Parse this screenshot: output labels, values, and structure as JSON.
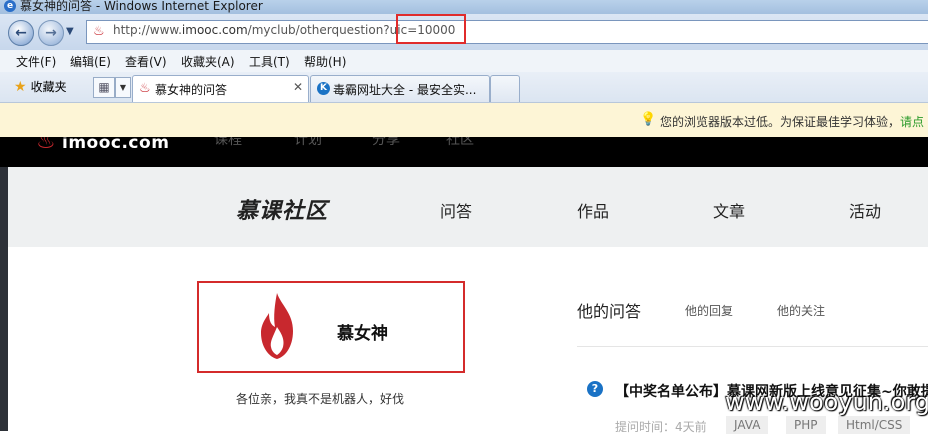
{
  "window": {
    "title": "慕女神的问答 - Windows Internet Explorer"
  },
  "address": {
    "url_prefix": "http://www.",
    "url_domain": "imooc.com",
    "url_path": "/myclub/otherquestion?uic=10000"
  },
  "menu": [
    "文件(F)",
    "编辑(E)",
    "查看(V)",
    "收藏夹(A)",
    "工具(T)",
    "帮助(H)"
  ],
  "favorites_label": "收藏夹",
  "tabs": [
    {
      "label": "慕女神的问答",
      "active": true
    },
    {
      "label": "毒霸网址大全 - 最安全实...",
      "active": false
    }
  ],
  "infobar": {
    "message": "您的浏览器版本过低。为保证最佳学习体验，",
    "link": "请点"
  },
  "site": {
    "logo": "imooc.com",
    "nav_dim": [
      "课程",
      "计划",
      "分享",
      "社区"
    ]
  },
  "community": {
    "brand": "慕课社区",
    "nav": [
      "问答",
      "作品",
      "文章",
      "活动"
    ]
  },
  "profile": {
    "name": "慕女神",
    "bio": "各位亲，我真不是机器人，好伐"
  },
  "content_tabs": {
    "questions": "他的问答",
    "replies": "他的回复",
    "follows": "他的关注"
  },
  "question": {
    "title": "【中奖名单公布】慕课网新版上线意见征集~你敢提",
    "time": "提问时间：4天前",
    "tags": [
      "JAVA",
      "PHP",
      "Html/CSS"
    ]
  },
  "watermark": "www.wooyun.org",
  "colors": {
    "brand_red": "#c8282e",
    "highlight_box": "#e02b2b",
    "link_green": "#2a9a2a"
  }
}
